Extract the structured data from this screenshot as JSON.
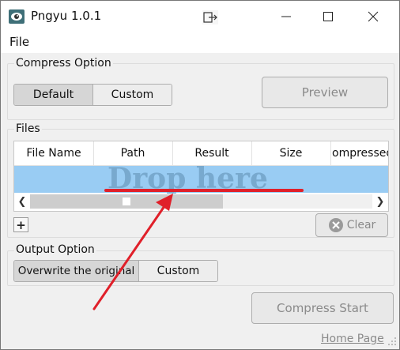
{
  "window": {
    "title": "Pngyu 1.0.1",
    "minimize_icon": "minimize-icon",
    "maximize_icon": "maximize-icon",
    "close_icon": "close-icon"
  },
  "menu": {
    "file": "File"
  },
  "compress_option": {
    "title": "Compress Option",
    "default_label": "Default",
    "custom_label": "Custom",
    "selected": "Default",
    "preview_label": "Preview"
  },
  "files": {
    "title": "Files",
    "columns": [
      "File Name",
      "Path",
      "Result",
      "Size",
      "ompressed"
    ],
    "drop_hint": "Drop here",
    "add_label": "+",
    "clear_label": "Clear"
  },
  "output_option": {
    "title": "Output Option",
    "overwrite_label": "Overwrite the original",
    "custom_label": "Custom",
    "selected": "Overwrite the original"
  },
  "compress_start_label": "Compress Start",
  "home_page_label": "Home Page",
  "colors": {
    "drop_zone": "#99ccf3",
    "annotation_red": "#e0202a"
  }
}
